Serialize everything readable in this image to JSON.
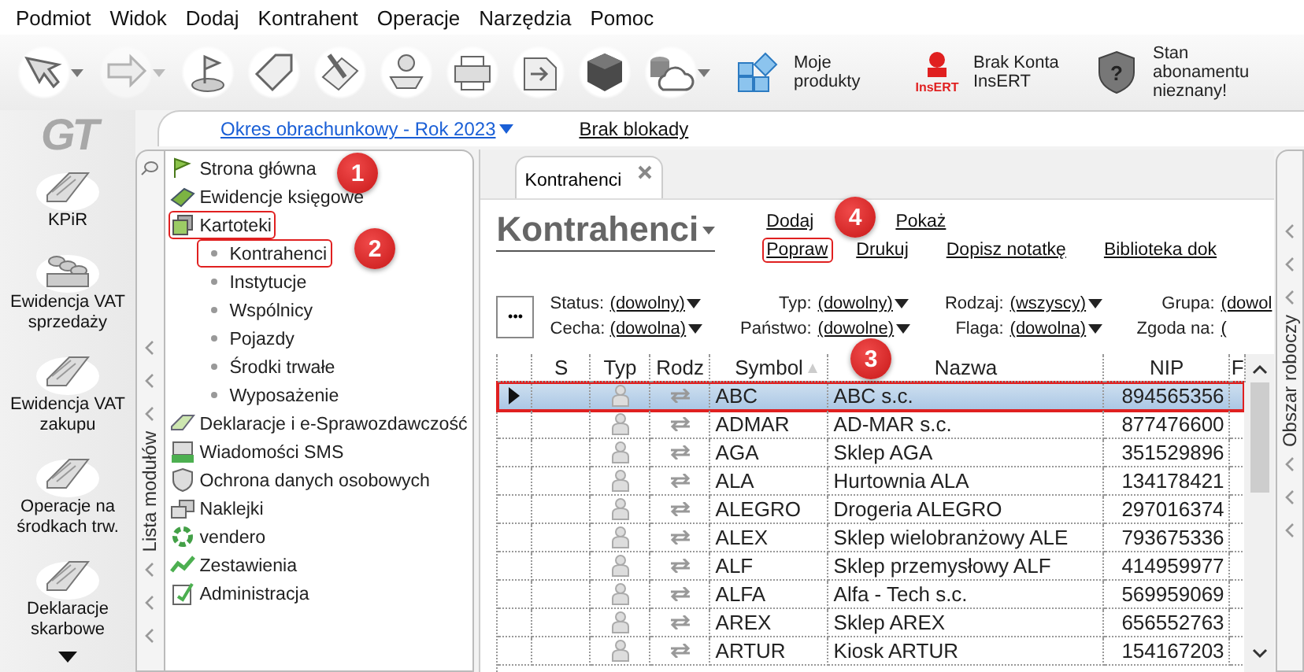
{
  "menu": [
    "Podmiot",
    "Widok",
    "Dodaj",
    "Kontrahent",
    "Operacje",
    "Narzędzia",
    "Pomoc"
  ],
  "toolbar": {
    "icon_buttons": [
      {
        "has_menu": true,
        "disabled": false
      },
      {
        "has_menu": true,
        "disabled": true
      },
      {
        "has_menu": false,
        "disabled": false
      },
      {
        "has_menu": false,
        "disabled": false
      },
      {
        "has_menu": false,
        "disabled": false
      },
      {
        "has_menu": false,
        "disabled": false
      },
      {
        "has_menu": false,
        "disabled": false
      },
      {
        "has_menu": false,
        "disabled": false
      },
      {
        "has_menu": false,
        "disabled": false
      },
      {
        "has_menu": true,
        "disabled": false
      }
    ],
    "labeled_buttons": [
      {
        "label": "Moje produkty"
      },
      {
        "label": "Brak Konta InsERT",
        "logo_text": "InsERT"
      },
      {
        "label": "Stan abonamentu nieznany!",
        "icon_text": "?"
      }
    ]
  },
  "logo": "GT",
  "modules": [
    {
      "label": "KPiR"
    },
    {
      "label": "Ewidencja VAT sprzedaży"
    },
    {
      "label": "Ewidencja VAT zakupu"
    },
    {
      "label": "Operacje na środkach trw."
    },
    {
      "label": "Deklaracje skarbowe"
    }
  ],
  "period_link": "Okres obrachunkowy - Rok 2023",
  "lock_link": "Brak blokady",
  "module_list_label": "Lista modułów",
  "tree": [
    {
      "label": "Strona główna",
      "outlined": false
    },
    {
      "label": "Ewidencje księgowe",
      "outlined": false
    },
    {
      "label": "Kartoteki",
      "outlined": true,
      "children": [
        {
          "label": "Kontrahenci",
          "outlined": true
        },
        {
          "label": "Instytucje",
          "outlined": false
        },
        {
          "label": "Wspólnicy",
          "outlined": false
        },
        {
          "label": "Pojazdy",
          "outlined": false
        },
        {
          "label": "Środki trwałe",
          "outlined": false
        },
        {
          "label": "Wyposażenie",
          "outlined": false
        }
      ]
    },
    {
      "label": "Deklaracje i e-Sprawozdawczość",
      "outlined": false
    },
    {
      "label": "Wiadomości SMS",
      "outlined": false
    },
    {
      "label": "Ochrona danych osobowych",
      "outlined": false
    },
    {
      "label": "Naklejki",
      "outlined": false
    },
    {
      "label": "vendero",
      "outlined": false
    },
    {
      "label": "Zestawienia",
      "outlined": false
    },
    {
      "label": "Administracja",
      "outlined": false
    }
  ],
  "tabs": [
    {
      "label": "Kontrahenci",
      "selected": true
    }
  ],
  "title": "Kontrahenci",
  "actions": [
    [
      {
        "label": "Dodaj",
        "outlined": false
      },
      {
        "label": "Pokaż",
        "outlined": false
      }
    ],
    [
      {
        "label": "Popraw",
        "outlined": true
      },
      {
        "label": "Drukuj",
        "outlined": false
      },
      {
        "label": "Dopisz notatkę",
        "outlined": false
      },
      {
        "label": "Biblioteka dok",
        "outlined": false
      }
    ]
  ],
  "more_button": "•••",
  "filters": [
    [
      {
        "label": "Status:",
        "value": "(dowolny)"
      },
      {
        "label": "Typ:",
        "value": "(dowolny)"
      },
      {
        "label": "Rodzaj:",
        "value": "(wszyscy)"
      },
      {
        "label": "Grupa:",
        "value": "(dowol"
      }
    ],
    [
      {
        "label": "Cecha:",
        "value": "(dowolna)"
      },
      {
        "label": "Państwo:",
        "value": "(dowolne)"
      },
      {
        "label": "Flaga:",
        "value": "(dowolna)"
      },
      {
        "label": "Zgoda na:",
        "value": "("
      }
    ]
  ],
  "table": {
    "columns": [
      {
        "label": "S",
        "sorted": false
      },
      {
        "label": "Typ",
        "sorted": false
      },
      {
        "label": "Rodz",
        "sorted": false
      },
      {
        "label": "Symbol",
        "sorted": true
      },
      {
        "label": "Nazwa",
        "sorted": false
      },
      {
        "label": "NIP",
        "sorted": false
      },
      {
        "label": "F",
        "sorted": false
      }
    ],
    "rows": [
      {
        "symbol": "ABC",
        "name": "ABC s.c.",
        "nip": "894565356",
        "selected": true,
        "outlined": true
      },
      {
        "symbol": "ADMAR",
        "name": "AD-MAR s.c.",
        "nip": "877476600",
        "selected": false,
        "outlined": false
      },
      {
        "symbol": "AGA",
        "name": "Sklep AGA",
        "nip": "351529896",
        "selected": false,
        "outlined": false
      },
      {
        "symbol": "ALA",
        "name": "Hurtownia ALA",
        "nip": "134178421",
        "selected": false,
        "outlined": false
      },
      {
        "symbol": "ALEGRO",
        "name": "Drogeria ALEGRO",
        "nip": "297016374",
        "selected": false,
        "outlined": false
      },
      {
        "symbol": "ALEX",
        "name": "Sklep wielobranżowy  ALE",
        "nip": "793675336",
        "selected": false,
        "outlined": false
      },
      {
        "symbol": "ALF",
        "name": "Sklep przemysłowy ALF",
        "nip": "414959977",
        "selected": false,
        "outlined": false
      },
      {
        "symbol": "ALFA",
        "name": "Alfa - Tech s.c.",
        "nip": "569959069",
        "selected": false,
        "outlined": false
      },
      {
        "symbol": "AREX",
        "name": "Sklep AREX",
        "nip": "656552763",
        "selected": false,
        "outlined": false
      },
      {
        "symbol": "ARTUR",
        "name": "Kiosk ARTUR",
        "nip": "154167203",
        "selected": false,
        "outlined": false
      }
    ]
  },
  "workspace_label": "Obszar roboczy",
  "annotations": [
    {
      "label": "1"
    },
    {
      "label": "2"
    },
    {
      "label": "3"
    },
    {
      "label": "4"
    }
  ]
}
